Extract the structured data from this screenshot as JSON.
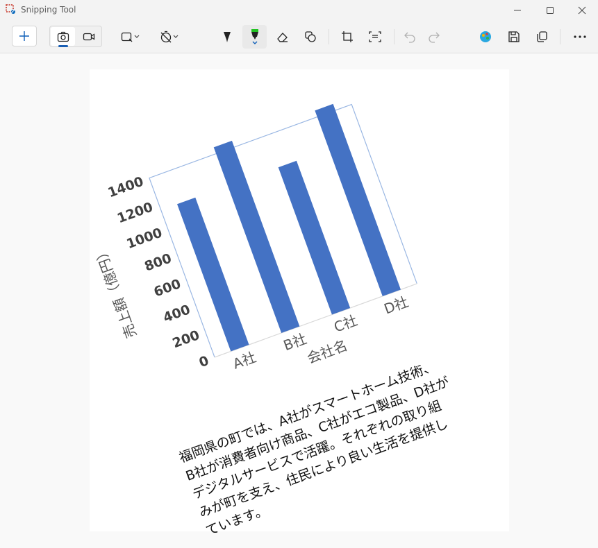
{
  "window": {
    "title": "Snipping Tool"
  },
  "toolbar": {
    "new_label": "+"
  },
  "chart_data": {
    "type": "bar",
    "categories": [
      "A社",
      "B社",
      "C社",
      "D社"
    ],
    "values": [
      1150,
      1450,
      1150,
      1450
    ],
    "xlabel": "会社名",
    "ylabel": "売上額（億円）",
    "ylim": [
      0,
      1400
    ],
    "yticks": [
      "0",
      "200",
      "400",
      "600",
      "800",
      "1000",
      "1200",
      "1400"
    ],
    "bar_color": "#4472c4"
  },
  "paragraph": {
    "text": "福岡県の町では、A社がスマートホーム技術、B社が消費者向け商品、C社がエコ製品、D社がデジタルサービスで活躍。それぞれの取り組みが町を支え、住民により良い生活を提供しています。",
    "lines": [
      "福岡県の町では、A社がスマートホーム技術、",
      "B社が消費者向け商品、C社がエコ製品、D社が",
      "デジタルサービスで活躍。それぞれの取り組",
      "みが町を支え、住民により良い生活を提供し",
      "ています。"
    ]
  }
}
